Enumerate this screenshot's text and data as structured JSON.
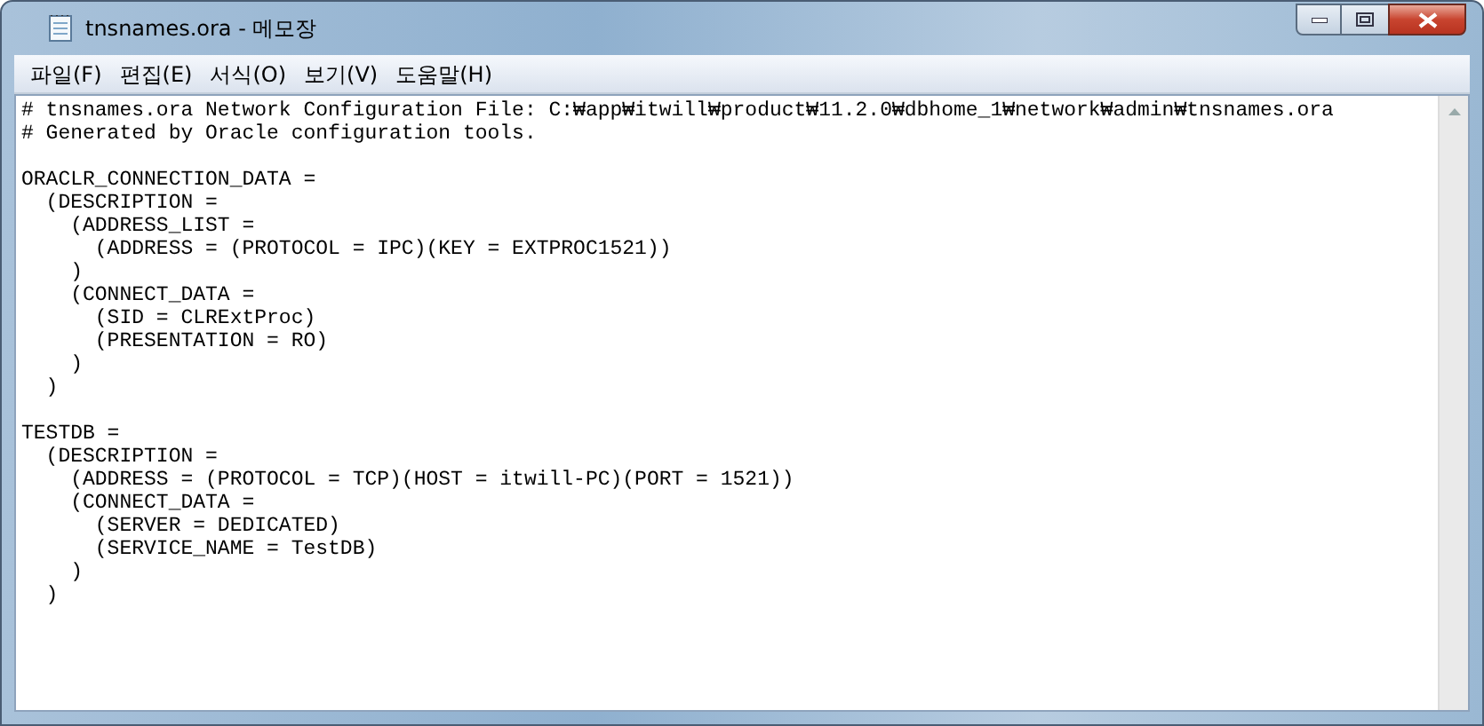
{
  "window": {
    "title": "tnsnames.ora - 메모장"
  },
  "menu": [
    {
      "label": "파일(F)"
    },
    {
      "label": "편집(E)"
    },
    {
      "label": "서식(O)"
    },
    {
      "label": "보기(V)"
    },
    {
      "label": "도움말(H)"
    }
  ],
  "editor": {
    "blocks": [
      [
        "# tnsnames.ora Network Configuration File: C:₩app₩itwill₩product₩11.2.0₩dbhome_1₩network₩admin₩tnsnames.ora",
        "# Generated by Oracle configuration tools."
      ],
      [
        "ORACLR_CONNECTION_DATA =",
        "  (DESCRIPTION =",
        "    (ADDRESS_LIST =",
        "      (ADDRESS = (PROTOCOL = IPC)(KEY = EXTPROC1521))",
        "    )",
        "    (CONNECT_DATA =",
        "      (SID = CLRExtProc)",
        "      (PRESENTATION = RO)",
        "    )",
        "  )"
      ],
      [
        "TESTDB =",
        "  (DESCRIPTION =",
        "    (ADDRESS = (PROTOCOL = TCP)(HOST = itwill-PC)(PORT = 1521))",
        "    (CONNECT_DATA =",
        "      (SERVER = DEDICATED)",
        "      (SERVICE_NAME = TestDB)",
        "    )",
        "  )"
      ]
    ]
  }
}
